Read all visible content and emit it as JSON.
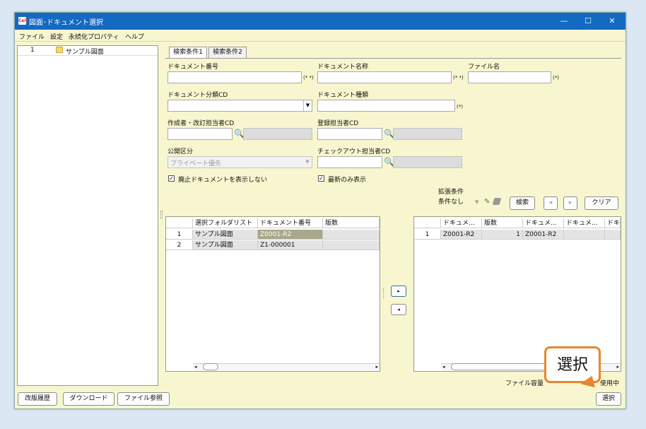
{
  "window": {
    "title": "図面･ドキュメント選択",
    "app_icon_text": "Cell"
  },
  "menubar": [
    "ファイル",
    "設定",
    "永続化プロパティ",
    "ヘルプ"
  ],
  "tree": {
    "row_num": "1",
    "label": "サンプル図面"
  },
  "tabs": [
    "検索条件1",
    "検索条件2"
  ],
  "form": {
    "doc_number_label": "ドキュメント番号",
    "doc_name_label": "ドキュメント名称",
    "file_name_label": "ファイル名",
    "wildcard_mark": "(* *)",
    "star_mark": "(*)",
    "doc_class_label": "ドキュメント分類CD",
    "doc_type_label": "ドキュメント種類",
    "author_label": "作成者・改訂担当者CD",
    "registrar_label": "登録担当者CD",
    "public_label": "公開区分",
    "public_value": "プライベート優先",
    "checkout_label": "チェックアウト担当者CD",
    "hide_obsolete_label": "廃止ドキュメントを表示しない",
    "latest_only_label": "最新のみ表示",
    "ext_label": "拡張条件",
    "ext_value": "条件なし",
    "search_button": "検索",
    "clear_button": "クリア"
  },
  "left_table": {
    "headers": [
      "選択フォルダリスト",
      "ドキュメント番号",
      "版数"
    ],
    "rows": [
      {
        "num": "1",
        "folder": "サンプル図面",
        "doc": "Z0001-R2",
        "rev": ""
      },
      {
        "num": "2",
        "folder": "サンプル図面",
        "doc": "Z1-000001",
        "rev": ""
      }
    ]
  },
  "right_table": {
    "headers": [
      "ドキュメ...",
      "版数",
      "ドキュメ...",
      "ドキュメ...",
      "ドキ..."
    ],
    "rows": [
      {
        "num": "1",
        "c1": "Z0001-R2",
        "c2": "1",
        "c3": "Z0001-R2",
        "c4": "",
        "c5": ""
      }
    ]
  },
  "status": {
    "file_capacity": "ファイル容量",
    "in_use": "使用中"
  },
  "bottom_buttons": [
    "改版履歴",
    "ダウンロード",
    "ファイル参照"
  ],
  "select_button": "選択",
  "callout_text": "選択"
}
